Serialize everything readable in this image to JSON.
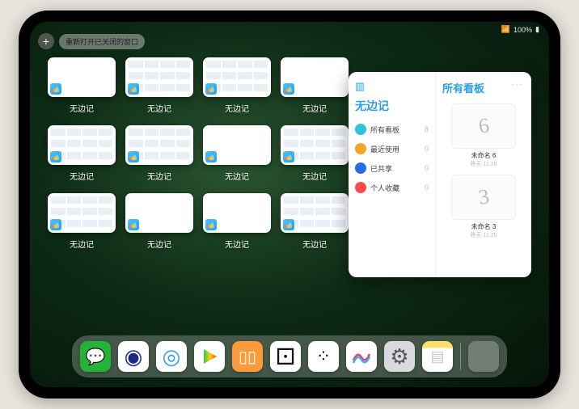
{
  "status_bar": {
    "wifi": "􀙇",
    "battery_text": "100%"
  },
  "top": {
    "plus": "+",
    "reopen_label": "重新打开已关闭的窗口"
  },
  "window_grid": {
    "items": [
      {
        "label": "无边记",
        "type": "blank"
      },
      {
        "label": "无边记",
        "type": "grid"
      },
      {
        "label": "无边记",
        "type": "grid"
      },
      {
        "label": "无边记",
        "type": "blank"
      },
      {
        "label": "无边记",
        "type": "grid"
      },
      {
        "label": "无边记",
        "type": "grid"
      },
      {
        "label": "无边记",
        "type": "blank"
      },
      {
        "label": "无边记",
        "type": "grid"
      },
      {
        "label": "无边记",
        "type": "grid"
      },
      {
        "label": "无边记",
        "type": "blank"
      },
      {
        "label": "无边记",
        "type": "blank"
      },
      {
        "label": "无边记",
        "type": "grid"
      }
    ]
  },
  "panel": {
    "left_title": "无边记",
    "rows": [
      {
        "icon_color": "#2ec4d9",
        "label": "所有看板",
        "count": "8"
      },
      {
        "icon_color": "#f5a623",
        "label": "最近使用",
        "count": "0"
      },
      {
        "icon_color": "#2a6be8",
        "label": "已共享",
        "count": "0"
      },
      {
        "icon_color": "#ff4d4d",
        "label": "个人收藏",
        "count": "0"
      }
    ],
    "right_title": "所有看板",
    "boards": [
      {
        "scribble": "6",
        "name": "未命名 6",
        "sub": "昨天 11:26"
      },
      {
        "scribble": "3",
        "name": "未命名 3",
        "sub": "昨天 11:25"
      }
    ]
  },
  "dock": {
    "apps": [
      {
        "name": "wechat",
        "bg": "#23b33a",
        "glyph": "💬"
      },
      {
        "name": "quark",
        "bg": "#ffffff",
        "glyph": "◉"
      },
      {
        "name": "qqbrowser",
        "bg": "#ffffff",
        "glyph": "◎"
      },
      {
        "name": "play",
        "bg": "#ffffff",
        "glyph": "▶"
      },
      {
        "name": "books",
        "bg": "#ff9a3c",
        "glyph": "▯▯"
      },
      {
        "name": "dice",
        "bg": "#ffffff",
        "glyph": "⚀"
      },
      {
        "name": "gamepad",
        "bg": "#ffffff",
        "glyph": "⁘"
      },
      {
        "name": "freeform",
        "bg": "#ffffff",
        "glyph": "〰"
      },
      {
        "name": "settings",
        "bg": "#d9d9de",
        "glyph": "⚙"
      },
      {
        "name": "notes",
        "bg": "#fff",
        "glyph": "▤"
      }
    ]
  }
}
